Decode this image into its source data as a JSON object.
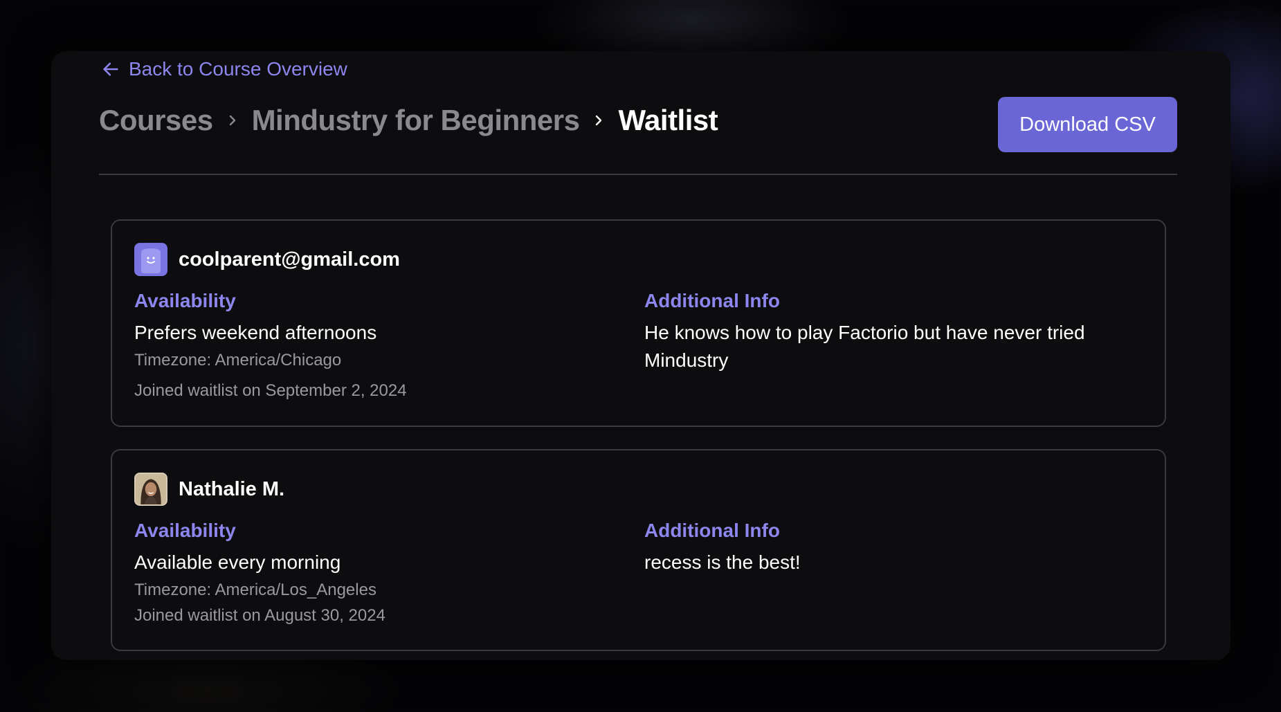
{
  "nav": {
    "back_label": "Back to Course Overview"
  },
  "breadcrumb": {
    "items": [
      {
        "label": "Courses"
      },
      {
        "label": "Mindustry for Beginners"
      },
      {
        "label": "Waitlist"
      }
    ]
  },
  "actions": {
    "download_label": "Download CSV"
  },
  "colors": {
    "accent": "#6b66d6",
    "link": "#8d86ee",
    "background": "#0d0d0f"
  },
  "entries": [
    {
      "name": "coolparent@gmail.com",
      "avatar_icon": "smiley-blob-icon",
      "availability_title": "Availability",
      "availability": "Prefers weekend afternoons",
      "timezone": "Timezone: America/Chicago",
      "info_title": "Additional Info",
      "info": "He knows how to play Factorio but have never tried Mindustry",
      "joined": "Joined waitlist on September 2, 2024"
    },
    {
      "name": "Nathalie M.",
      "avatar_icon": "user-photo",
      "availability_title": "Availability",
      "availability": "Available every morning",
      "timezone": "Timezone: America/Los_Angeles",
      "info_title": "Additional Info",
      "info": "recess is the best!",
      "joined": "Joined waitlist on August 30, 2024"
    }
  ]
}
